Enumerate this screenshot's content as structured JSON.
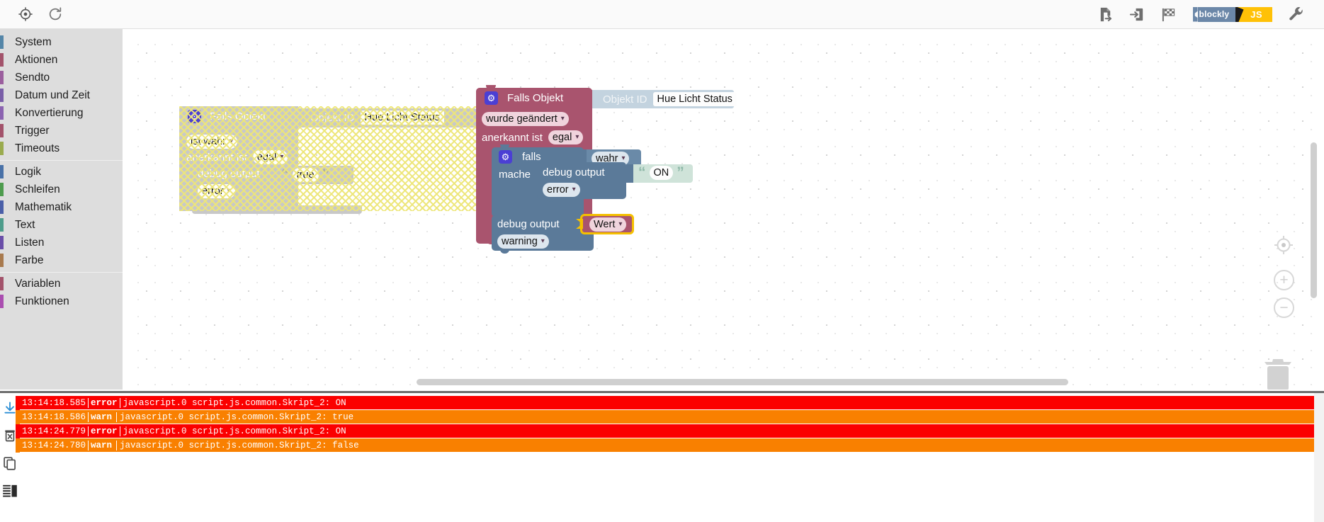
{
  "toolbar": {
    "left_icons": [
      {
        "name": "center-target-icon",
        "label": "Zentrieren"
      },
      {
        "name": "reload-icon",
        "label": "Neu laden"
      }
    ],
    "right_icons": [
      {
        "name": "export-file-icon",
        "label": "Exportieren"
      },
      {
        "name": "import-file-icon",
        "label": "Importieren"
      },
      {
        "name": "checkered-flag-icon",
        "label": "Start"
      },
      {
        "name": "wrench-icon",
        "label": "Einstellungen"
      }
    ],
    "toggle": {
      "blockly_label": "blockly",
      "js_label": "JS",
      "blockly_color": "#6b87a8",
      "js_color": "#ffc107"
    }
  },
  "sidebar": {
    "groups": [
      {
        "items": [
          {
            "label": "System",
            "color": "#5586a8"
          },
          {
            "label": "Aktionen",
            "color": "#a3536b"
          },
          {
            "label": "Sendto",
            "color": "#9b5f9e"
          },
          {
            "label": "Datum und Zeit",
            "color": "#7a5fa8"
          },
          {
            "label": "Konvertierung",
            "color": "#8b63b0"
          },
          {
            "label": "Trigger",
            "color": "#a3536b"
          },
          {
            "label": "Timeouts",
            "color": "#9aab4e"
          }
        ]
      },
      {
        "items": [
          {
            "label": "Logik",
            "color": "#4a72a8"
          },
          {
            "label": "Schleifen",
            "color": "#4e9c4e"
          },
          {
            "label": "Mathematik",
            "color": "#4a5fa8"
          },
          {
            "label": "Text",
            "color": "#4e9c8b"
          },
          {
            "label": "Listen",
            "color": "#6a4ea8"
          },
          {
            "label": "Farbe",
            "color": "#a87a4e"
          }
        ]
      },
      {
        "items": [
          {
            "label": "Variablen",
            "color": "#a3536b"
          },
          {
            "label": "Funktionen",
            "color": "#aa4eb0"
          }
        ]
      }
    ]
  },
  "workspace": {
    "disabled_block": {
      "title": "Falls Objekt",
      "gear_icon": "gear-icon",
      "object_id_label": "Objekt ID",
      "object_id_value": "Hue Licht Status",
      "condition_dropdown": "ist wahr",
      "ack_label": "anerkannt ist",
      "ack_dropdown": "egal",
      "debug_label": "debug output",
      "debug_text": "true",
      "severity_dropdown": "error"
    },
    "active_block": {
      "title": "Falls Objekt",
      "gear_icon": "gear-icon",
      "object_id_label": "Objekt ID",
      "object_id_value": "Hue Licht Status",
      "condition_dropdown": "wurde geändert",
      "ack_label": "anerkannt ist",
      "ack_dropdown": "egal",
      "inner_if": {
        "gear_icon": "gear-icon",
        "if_label": "falls",
        "if_value": "wahr",
        "do_label": "mache",
        "debug_label": "debug output",
        "debug_text": "ON",
        "severity_dropdown": "error"
      },
      "trailing_debug_label": "debug output",
      "trailing_debug_variable": "Wert",
      "trailing_severity_dropdown": "warning"
    },
    "controls": [
      {
        "name": "recenter-button",
        "glyph": "target"
      },
      {
        "name": "zoom-in-button",
        "glyph": "+"
      },
      {
        "name": "zoom-out-button",
        "glyph": "−"
      },
      {
        "name": "trash-button",
        "glyph": "trash"
      }
    ]
  },
  "log": {
    "tools": [
      {
        "name": "scroll-to-bottom-icon"
      },
      {
        "name": "clear-log-icon"
      },
      {
        "name": "copy-log-icon"
      },
      {
        "name": "log-layout-icon"
      }
    ],
    "colors": {
      "error": "#fb0000",
      "warn": "#f98000"
    },
    "rows": [
      {
        "time": "13:14:18.585",
        "severity": "error",
        "message": "javascript.0 script.js.common.Skript_2: ON",
        "level": "error"
      },
      {
        "time": "13:14:18.586",
        "severity": "warn",
        "message": "javascript.0 script.js.common.Skript_2: true",
        "level": "warn"
      },
      {
        "time": "13:14:24.779",
        "severity": "error",
        "message": "javascript.0 script.js.common.Skript_2: ON",
        "level": "error"
      },
      {
        "time": "13:14:24.780",
        "severity": "warn",
        "message": "javascript.0 script.js.common.Skript_2: false",
        "level": "warn"
      }
    ]
  }
}
